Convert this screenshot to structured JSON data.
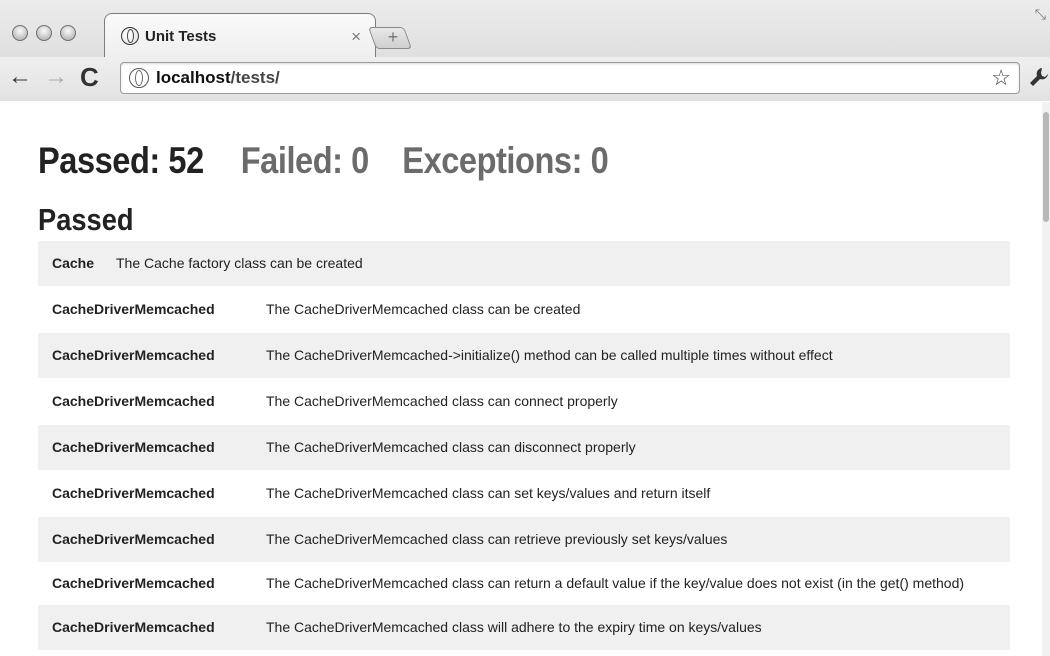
{
  "window": {
    "tab_title": "Unit Tests",
    "tab_close": "×",
    "new_tab": "+",
    "resize": "⤡"
  },
  "toolbar": {
    "back": "←",
    "forward": "→",
    "reload": "C",
    "url_host": "localhost",
    "url_path": "/tests/",
    "star": "☆",
    "wrench": "🔧"
  },
  "summary": {
    "passed": "Passed: 52",
    "failed": "Failed: 0",
    "exceptions": "Exceptions: 0"
  },
  "section_title": "Passed",
  "tests": [
    {
      "class": "Cache",
      "description": "The Cache factory class can be created"
    },
    {
      "class": "CacheDriverMemcached",
      "description": "The CacheDriverMemcached class can be created"
    },
    {
      "class": "CacheDriverMemcached",
      "description": "The CacheDriverMemcached->initialize() method can be called multiple times without effect"
    },
    {
      "class": "CacheDriverMemcached",
      "description": "The CacheDriverMemcached class can connect properly"
    },
    {
      "class": "CacheDriverMemcached",
      "description": "The CacheDriverMemcached class can disconnect properly"
    },
    {
      "class": "CacheDriverMemcached",
      "description": "The CacheDriverMemcached class can set keys/values and return itself"
    },
    {
      "class": "CacheDriverMemcached",
      "description": "The CacheDriverMemcached class can retrieve previously set keys/values"
    },
    {
      "class": "CacheDriverMemcached",
      "description": "The CacheDriverMemcached class can return a default value if the key/value does not exist (in the get() method)"
    },
    {
      "class": "CacheDriverMemcached",
      "description": "The CacheDriverMemcached class will adhere to the expiry time on keys/values"
    }
  ]
}
